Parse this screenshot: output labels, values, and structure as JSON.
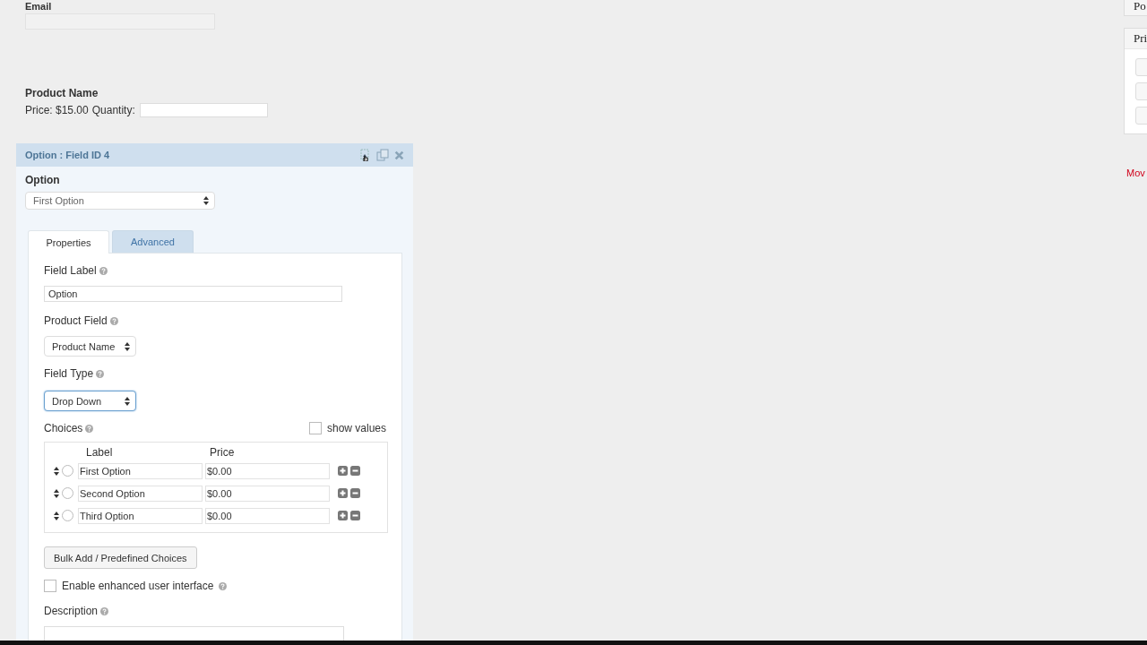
{
  "email_field": {
    "label": "Email"
  },
  "product": {
    "name": "Product Name",
    "price_text": "Price: $15.00",
    "quantity_label": "Quantity:"
  },
  "field_editor": {
    "title": "Option : Field ID 4",
    "option_label": "Option",
    "option_select": "First Option",
    "tabs": [
      {
        "label": "Properties",
        "selected": true
      },
      {
        "label": "Advanced",
        "selected": false
      }
    ],
    "field_label": {
      "label": "Field Label",
      "value": "Option"
    },
    "product_field": {
      "label": "Product Field",
      "value": "Product Name"
    },
    "field_type": {
      "label": "Field Type",
      "value": "Drop Down",
      "focused": true
    },
    "choices": {
      "label": "Choices",
      "show_values": {
        "label": "show values",
        "checked": false
      },
      "columns": [
        "Label",
        "Price"
      ],
      "rows": [
        {
          "label": "First Option",
          "price": "$0.00",
          "selected": false
        },
        {
          "label": "Second Option",
          "price": "$0.00",
          "selected": false
        },
        {
          "label": "Third Option",
          "price": "$0.00",
          "selected": false
        }
      ]
    },
    "bulk_button": "Bulk Add / Predefined Choices",
    "enhanced_ui": {
      "label": "Enable enhanced user interface",
      "checked": false
    },
    "description_label": "Description"
  },
  "right_panel": {
    "panels": [
      "Po",
      "Pri"
    ],
    "link": "Mov"
  }
}
